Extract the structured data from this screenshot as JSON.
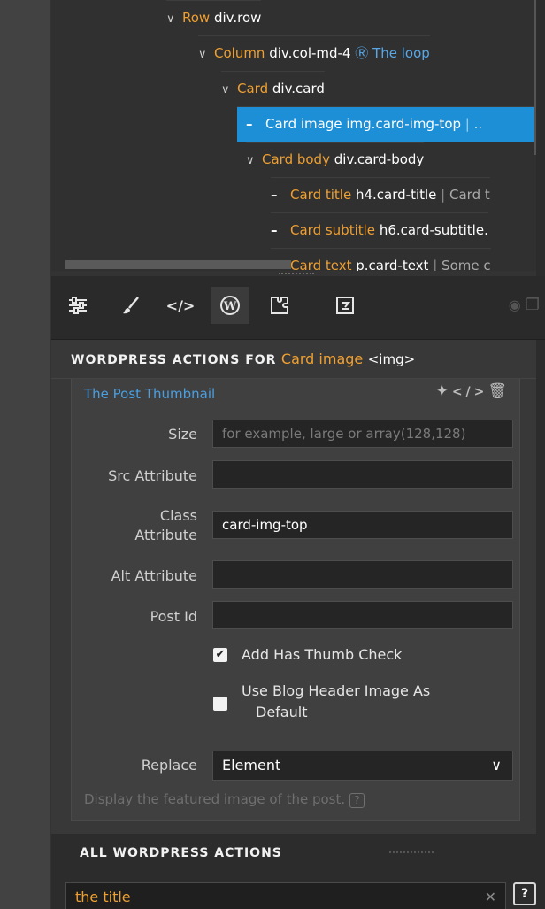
{
  "tree": {
    "rows": [
      {
        "kind": "Row",
        "selector": "div.row"
      },
      {
        "kind": "Column",
        "selector": "div.col-md-4",
        "wp": "The loop"
      },
      {
        "kind": "Card",
        "selector": "div.card"
      },
      {
        "kind": "Card image",
        "selector": "img.card-img-top",
        "sep": "|",
        "rest": ".."
      },
      {
        "kind": "Card body",
        "selector": "div.card-body"
      },
      {
        "kind": "Card title",
        "selector": "h4.card-title",
        "sep": "|",
        "rest": "Card t"
      },
      {
        "kind": "Card subtitle",
        "selector": "h6.card-subtitle.",
        "sep": "",
        "rest": ""
      },
      {
        "kind": "Card text",
        "selector": "p.card-text",
        "sep": "|",
        "rest": "Some c"
      }
    ]
  },
  "toolbar": {
    "icons": [
      "sliders-icon",
      "brush-icon",
      "code-icon",
      "wordpress-icon",
      "puzzle-icon",
      "component-icon",
      "eye-icon",
      "window-icon"
    ]
  },
  "panel": {
    "heading_prefix": "WORDPRESS ACTIONS FOR",
    "element_name": "Card image",
    "element_tag": "<img>",
    "action": {
      "title": "The Post Thumbnail",
      "fields": {
        "size_label": "Size",
        "size_placeholder": "for example, large or array(128,128)",
        "src_label": "Src Attribute",
        "src_value": "",
        "class_label_1": "Class",
        "class_label_2": "Attribute",
        "class_value": "card-img-top",
        "alt_label": "Alt Attribute",
        "alt_value": "",
        "postid_label": "Post Id",
        "postid_value": ""
      },
      "checks": {
        "thumb_label": "Add Has Thumb Check",
        "thumb_checked": "✔",
        "blog_label_1": "Use Blog Header Image As",
        "blog_label_2": "Default"
      },
      "replace_label": "Replace",
      "replace_value": "Element",
      "help": "Display the featured image of the post."
    }
  },
  "all_actions": {
    "heading": "ALL WORDPRESS ACTIONS",
    "search_value": "the title",
    "help_button": "?"
  }
}
